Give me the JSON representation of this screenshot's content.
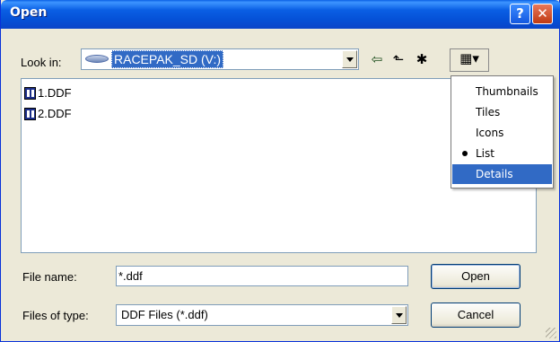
{
  "window": {
    "title": "Open",
    "help_glyph": "?",
    "close_glyph": "✕"
  },
  "lookin": {
    "label": "Look in:",
    "value": "RACEPAK_SD (V:)"
  },
  "toolbar": {
    "back_glyph": "⇦",
    "up_glyph": "⬑",
    "newfolder_glyph": "✱",
    "views_glyph": "▦▾"
  },
  "files": [
    {
      "name": "1.DDF"
    },
    {
      "name": "2.DDF"
    }
  ],
  "views_menu": {
    "items": [
      {
        "label": "Thumbnails",
        "checked": false,
        "selected": false
      },
      {
        "label": "Tiles",
        "checked": false,
        "selected": false
      },
      {
        "label": "Icons",
        "checked": false,
        "selected": false
      },
      {
        "label": "List",
        "checked": true,
        "selected": false
      },
      {
        "label": "Details",
        "checked": false,
        "selected": true
      }
    ]
  },
  "filename": {
    "label": "File name:",
    "value": "*.ddf"
  },
  "filetype": {
    "label": "Files of type:",
    "value": "DDF Files (*.ddf)"
  },
  "buttons": {
    "open": "Open",
    "cancel": "Cancel"
  },
  "colors": {
    "titlebar": "#0a5fe4",
    "selection": "#316ac5",
    "face": "#ece9d8"
  }
}
